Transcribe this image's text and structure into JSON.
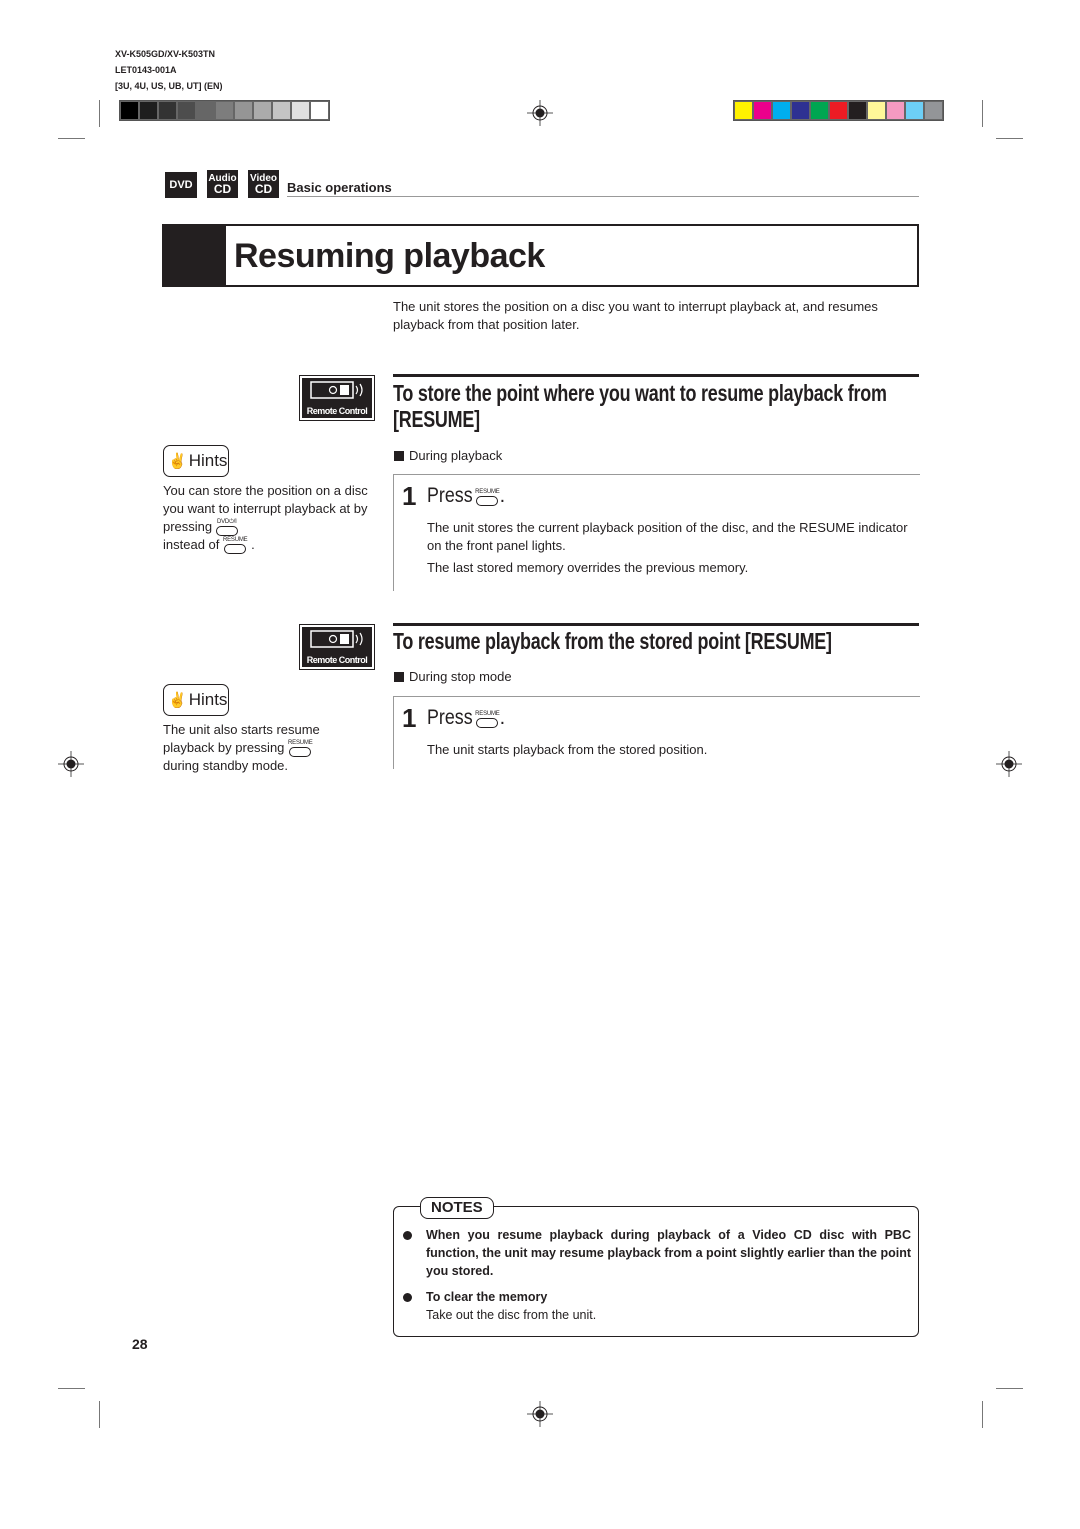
{
  "print_meta": {
    "model": "XV-K505GD/XV-K503TN",
    "code": "LET0143-001A",
    "regions": "[3U, 4U, US, UB, UT]   (EN)"
  },
  "gray_swatches": [
    "#000000",
    "#1e1e1e",
    "#333333",
    "#4d4d4d",
    "#666666",
    "#7d7d7d",
    "#959595",
    "#ababab",
    "#c4c4c4",
    "#e0e0e0",
    "#ffffff"
  ],
  "color_swatches": [
    "#fff200",
    "#ec008c",
    "#00aeef",
    "#2e3192",
    "#00a651",
    "#ed1c24",
    "#231f20",
    "#fff799",
    "#f49ac1",
    "#6dcff6",
    "#939598"
  ],
  "badges": [
    {
      "line1": "DVD",
      "line2": ""
    },
    {
      "line1": "Audio",
      "line2": "CD"
    },
    {
      "line1": "Video",
      "line2": "CD"
    }
  ],
  "section": "Basic operations",
  "title": "Resuming playback",
  "intro": "The unit stores the position on a disc you want to interrupt playback at, and resumes playback from that position later.",
  "remote_label": "Remote Control",
  "hints_label": "Hints",
  "sections": [
    {
      "heading": "To store the point where you want to resume playback from [RESUME]",
      "condition": "During playback",
      "step_number": "1",
      "press": "Press",
      "button_label": "RESUME",
      "paragraphs": [
        "The unit stores the current playback position of the disc, and the RESUME indicator on the front panel lights.",
        "The last stored memory overrides the previous memory."
      ],
      "hint": {
        "part1": "You can store the position on a disc you want to interrupt playback at by pressing",
        "button1": "DVD⏻/I",
        "part2": "instead of",
        "button2": "RESUME",
        "part3": "."
      }
    },
    {
      "heading": "To resume playback from the stored point [RESUME]",
      "condition": "During stop mode",
      "step_number": "1",
      "press": "Press",
      "button_label": "RESUME",
      "paragraphs": [
        "The unit starts playback from the stored position."
      ],
      "hint": {
        "part1": "The unit also starts resume playback by pressing",
        "button1": "RESUME",
        "part2": "during standby mode."
      }
    }
  ],
  "notes": {
    "label": "NOTES",
    "items": [
      {
        "bold": "When you resume playback during playback of a Video CD disc with PBC function, the unit may resume playback from a point slightly earlier than the point you stored.",
        "text": ""
      },
      {
        "bold": "To clear the memory",
        "text": "Take out the disc from the unit."
      }
    ]
  },
  "page_number": "28"
}
